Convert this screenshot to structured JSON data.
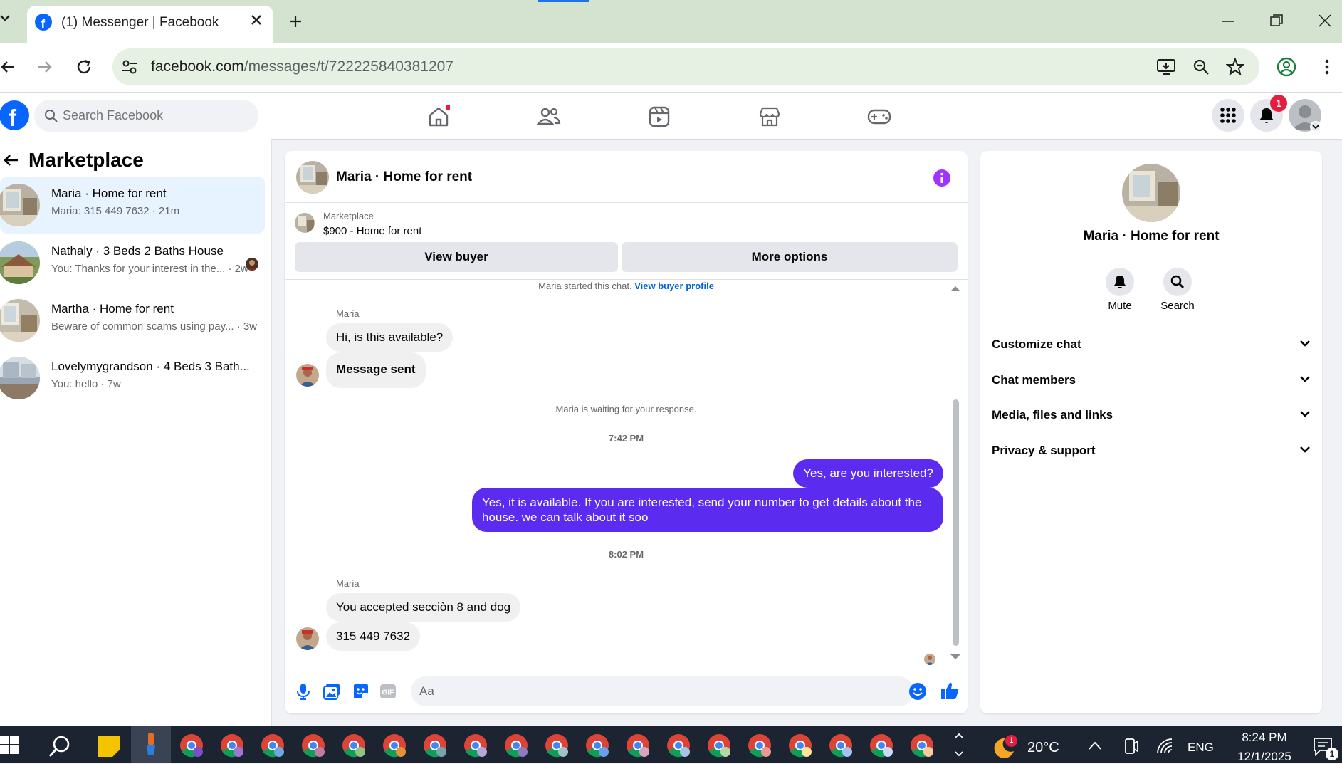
{
  "browser": {
    "tab_title": "(1) Messenger | Facebook",
    "url_domain": "facebook.com",
    "url_path": "/messages/t/722225840381207"
  },
  "fb": {
    "search_placeholder": "Search Facebook",
    "notification_count": "1",
    "accent": "#0866ff"
  },
  "sidebar": {
    "title": "Marketplace",
    "conversations": [
      {
        "name": "Maria · Home for rent",
        "preview": "Maria: 315 449 7632 · 21m"
      },
      {
        "name": "Nathaly · 3 Beds 2 Baths House",
        "preview": "You: Thanks for your interest in the... · 2w"
      },
      {
        "name": "Martha · Home for rent",
        "preview": "Beware of common scams using pay... · 3w"
      },
      {
        "name": "Lovelymygrandson · 4 Beds 3 Bath...",
        "preview": "You: hello · 7w"
      }
    ]
  },
  "chat": {
    "header_name": "Maria · Home for rent",
    "listing_source": "Marketplace",
    "listing_title": "$900 - Home for rent",
    "view_buyer": "View buyer",
    "more_options": "More options",
    "started_text": "Maria started this chat.",
    "view_buyer_profile": "View buyer profile",
    "sender_label_1": "Maria",
    "msg_in_1": "Hi, is this available?",
    "msg_in_2": "Message sent",
    "waiting": "Maria is waiting for your response.",
    "time_1": "7:42 PM",
    "msg_out_1": "Yes, are you interested?",
    "msg_out_2": "Yes, it is available. If you are interested, send your number to get details about the house. we can talk about it soo",
    "time_2": "8:02 PM",
    "sender_label_2": "Maria",
    "msg_in_3": "You accepted secciòn 8 and dog",
    "msg_in_4": "315 449 7632",
    "composer_placeholder": "Aa",
    "out_color": "#5b2cf0"
  },
  "right_panel": {
    "name": "Maria · Home for rent",
    "mute": "Mute",
    "search": "Search",
    "sections": [
      "Customize chat",
      "Chat members",
      "Media, files and links",
      "Privacy & support"
    ]
  },
  "taskbar": {
    "weather_badge": "1",
    "temperature": "20°C",
    "language": "ENG",
    "time": "8:24 PM",
    "date": "12/1/2025",
    "notif": "1"
  }
}
